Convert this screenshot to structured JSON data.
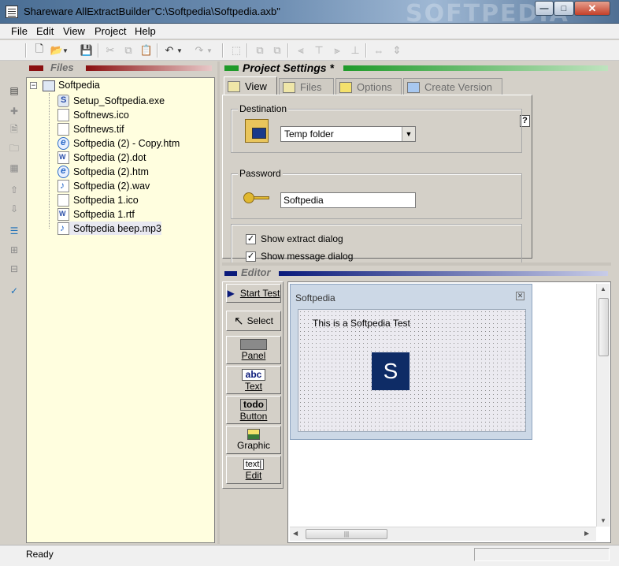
{
  "window": {
    "app_title": "Shareware AllExtractBuilder",
    "file_path": "\"C:\\Softpedia\\Softpedia.axb\"",
    "watermark": "SOFTPEDIA",
    "min_glyph": "—",
    "max_glyph": "□",
    "close_glyph": "✕"
  },
  "menu": [
    "File",
    "Edit",
    "View",
    "Project",
    "Help"
  ],
  "files_panel": {
    "title": "Files",
    "root": "Softpedia",
    "items": [
      {
        "name": "Setup_Softpedia.exe",
        "icon": "exe"
      },
      {
        "name": "Softnews.ico",
        "icon": "file"
      },
      {
        "name": "Softnews.tif",
        "icon": "file"
      },
      {
        "name": "Softpedia (2) - Copy.htm",
        "icon": "ie"
      },
      {
        "name": "Softpedia (2).dot",
        "icon": "word"
      },
      {
        "name": "Softpedia (2).htm",
        "icon": "ie"
      },
      {
        "name": "Softpedia (2).wav",
        "icon": "wav"
      },
      {
        "name": "Softpedia 1.ico",
        "icon": "file"
      },
      {
        "name": "Softpedia 1.rtf",
        "icon": "word"
      },
      {
        "name": "Softpedia beep.mp3",
        "icon": "wav"
      }
    ]
  },
  "project_settings": {
    "title": "Project Settings *",
    "tabs": [
      "View",
      "Files",
      "Options",
      "Create Version"
    ],
    "active_tab": "View",
    "help_glyph": "?",
    "destination": {
      "label": "Destination",
      "value": "Temp folder"
    },
    "password": {
      "label": "Password",
      "value": "Softpedia"
    },
    "checkboxes": [
      {
        "label": "Show extract dialog",
        "checked": true
      },
      {
        "label": "Show message dialog",
        "checked": true
      }
    ]
  },
  "editor": {
    "title": "Editor",
    "start_test": "Start Test",
    "select": "Select",
    "tools": [
      {
        "label": "Panel",
        "preview": ""
      },
      {
        "label": "Text",
        "preview": "abc"
      },
      {
        "label": "Button",
        "preview": "todo"
      },
      {
        "label": "Graphic",
        "preview": ""
      },
      {
        "label": "Edit",
        "preview": "text|"
      }
    ],
    "form": {
      "title": "Softpedia",
      "text": "This is a Softpedia Test",
      "logo": "S"
    }
  },
  "status": {
    "text": "Ready"
  },
  "colors": {
    "files_bg": "#fffedf",
    "header_green": "#1f9a2a",
    "header_red": "#8a1010",
    "header_blue": "#0a1a7a",
    "logo_blue": "#0e2c66"
  }
}
